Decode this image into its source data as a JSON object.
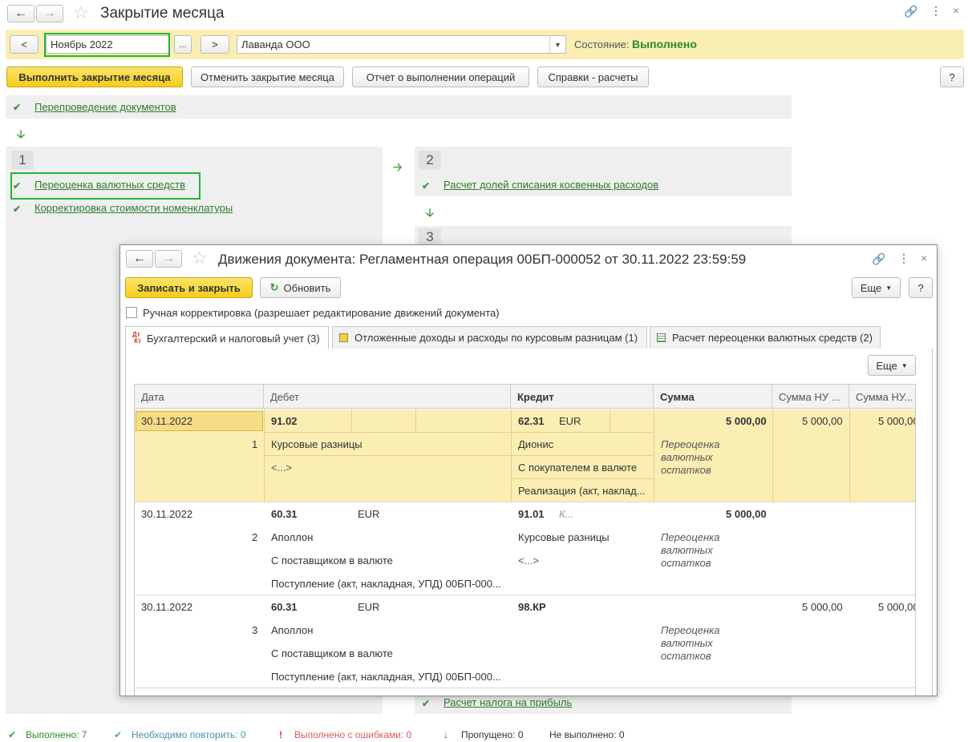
{
  "window": {
    "title": "Закрытие месяца",
    "period_prev": "<",
    "period_value": "Ноябрь 2022",
    "period_select": "...",
    "period_next": ">",
    "organization": "Лаванда ООО",
    "state_label": "Состояние:",
    "state_value": "Выполнено"
  },
  "toolbar": {
    "run_close": "Выполнить закрытие месяца",
    "cancel_close": "Отменить закрытие месяца",
    "report": "Отчет о выполнении операций",
    "calcs": "Справки - расчеты",
    "help": "?"
  },
  "steps": {
    "repost": "Перепроведение документов",
    "step1_num": "1",
    "step1_items": [
      "Переоценка валютных средств",
      "Корректировка стоимости номенклатуры"
    ],
    "step2_num": "2",
    "step2_items": [
      "Расчет долей списания косвенных расходов"
    ],
    "step3_num": "3",
    "profit_tax": "Расчет налога на прибыль"
  },
  "status": {
    "done": "Выполнено: 7",
    "repeat": "Необходимо повторить: 0",
    "errors": "Выполнено с ошибками: 0",
    "skipped": "Пропущено: 0",
    "not_done": "Не выполнено: 0"
  },
  "modal": {
    "title": "Движения документа: Регламентная операция 00БП-000052 от 30.11.2022 23:59:59",
    "save_close": "Записать и закрыть",
    "refresh": "Обновить",
    "more": "Еще",
    "help": "?",
    "manual_edit": "Ручная корректировка (разрешает редактирование движений документа)",
    "tabs": [
      "Бухгалтерский и налоговый учет (3)",
      "Отложенные доходы и расходы по курсовым разницам (1)",
      "Расчет переоценки валютных средств (2)"
    ],
    "tab_icon_text": "ДтКт",
    "grid_more": "Еще",
    "columns": [
      "Дата",
      "Дебет",
      "Кредит",
      "Сумма",
      "Сумма НУ ...",
      "Сумма НУ..."
    ],
    "rows": [
      {
        "date": "30.11.2022",
        "num": "1",
        "debit_acc": "91.02",
        "debit_cur": "",
        "debit_sub": [
          "Курсовые разницы",
          "<...>",
          ""
        ],
        "credit_acc": "62.31",
        "credit_cur": "EUR",
        "credit_sub": [
          "Дионис",
          "С покупателем в валюте",
          "Реализация (акт, наклад..."
        ],
        "sum": "5 000,00",
        "sum_desc": [
          "Переоценка",
          "валютных",
          "остатков"
        ],
        "nu1": "5 000,00",
        "nu2": "5 000,00"
      },
      {
        "date": "30.11.2022",
        "num": "2",
        "debit_acc": "60.31",
        "debit_cur": "EUR",
        "debit_sub": [
          "Аполлон",
          "С поставщиком в валюте",
          "Поступление (акт, накладная, УПД) 00БП-000..."
        ],
        "credit_acc": "91.01",
        "credit_cur": "К...",
        "credit_sub": [
          "Курсовые разницы",
          "<...>",
          ""
        ],
        "sum": "5 000,00",
        "sum_desc": [
          "Переоценка",
          "валютных",
          "остатков"
        ],
        "nu1": "",
        "nu2": ""
      },
      {
        "date": "30.11.2022",
        "num": "3",
        "debit_acc": "60.31",
        "debit_cur": "EUR",
        "debit_sub": [
          "Аполлон",
          "С поставщиком в валюте",
          "Поступление (акт, накладная, УПД) 00БП-000..."
        ],
        "credit_acc": "98.КР",
        "credit_cur": "",
        "credit_sub": [
          "",
          "",
          ""
        ],
        "sum": "",
        "sum_desc": [
          "Переоценка",
          "валютных",
          "остатков"
        ],
        "nu1": "5 000,00",
        "nu2": "5 000,00"
      }
    ]
  }
}
